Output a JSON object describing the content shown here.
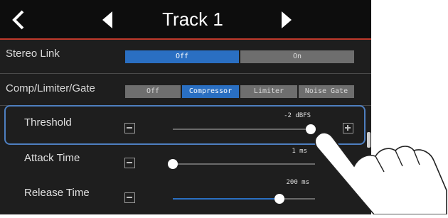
{
  "header": {
    "title": "Track 1"
  },
  "stereo_link": {
    "label": "Stereo Link",
    "options": [
      "Off",
      "On"
    ],
    "selected": "Off"
  },
  "comp": {
    "label": "Comp/Limiter/Gate",
    "options": [
      "Off",
      "Compressor",
      "Limiter",
      "Noise Gate"
    ],
    "selected": "Compressor"
  },
  "params": [
    {
      "label": "Threshold",
      "value": "-2 dBFS",
      "level": 0.97
    },
    {
      "label": "Attack Time",
      "value": "1 ms",
      "level": 0.0
    },
    {
      "label": "Release Time",
      "value": "200 ms",
      "level": 0.75
    }
  ],
  "colors": {
    "accent": "#2a6fc2",
    "header_line": "#c0392b",
    "highlight": "#4e7fc0"
  },
  "icons": [
    "back-icon",
    "prev-icon",
    "next-icon",
    "minus-icon",
    "plus-icon"
  ]
}
